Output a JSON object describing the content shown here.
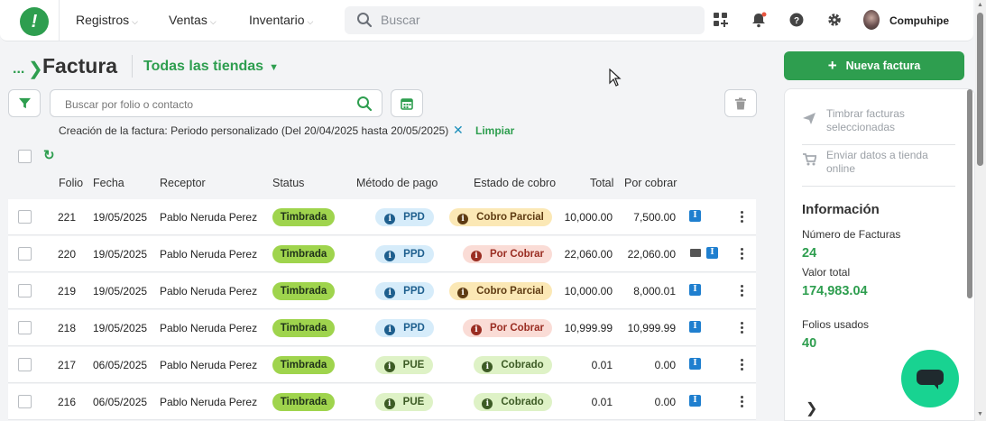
{
  "nav": {
    "items": [
      {
        "label": "Registros"
      },
      {
        "label": "Ventas"
      },
      {
        "label": "Inventario"
      }
    ],
    "search_placeholder": "Buscar",
    "user_name": "Compuhipe"
  },
  "page": {
    "breadcrumb": "...",
    "title": "Factura",
    "store_selector": "Todas las tiendas",
    "search_placeholder": "Buscar por folio o contacto",
    "filter_text": "Creación de la factura: Periodo personalizado (Del 20/04/2025 hasta 20/05/2025)",
    "clear_label": "Limpiar"
  },
  "table": {
    "headers": {
      "folio": "Folio",
      "fecha": "Fecha",
      "receptor": "Receptor",
      "status": "Status",
      "metodo": "Método de pago",
      "estado": "Estado de cobro",
      "total": "Total",
      "por_cobrar": "Por cobrar"
    },
    "rows": [
      {
        "folio": "221",
        "fecha": "19/05/2025",
        "receptor": "Pablo Neruda Perez",
        "status": "Timbrada",
        "metodo": "PPD",
        "estado": "Cobro Parcial",
        "total": "10,000.00",
        "por_cobrar": "7,500.00"
      },
      {
        "folio": "220",
        "fecha": "19/05/2025",
        "receptor": "Pablo Neruda Perez",
        "status": "Timbrada",
        "metodo": "PPD",
        "estado": "Por Cobrar",
        "total": "22,060.00",
        "por_cobrar": "22,060.00"
      },
      {
        "folio": "219",
        "fecha": "19/05/2025",
        "receptor": "Pablo Neruda Perez",
        "status": "Timbrada",
        "metodo": "PPD",
        "estado": "Cobro Parcial",
        "total": "10,000.00",
        "por_cobrar": "8,000.01"
      },
      {
        "folio": "218",
        "fecha": "19/05/2025",
        "receptor": "Pablo Neruda Perez",
        "status": "Timbrada",
        "metodo": "PPD",
        "estado": "Por Cobrar",
        "total": "10,999.99",
        "por_cobrar": "10,999.99"
      },
      {
        "folio": "217",
        "fecha": "06/05/2025",
        "receptor": "Pablo Neruda Perez",
        "status": "Timbrada",
        "metodo": "PUE",
        "estado": "Cobrado",
        "total": "0.01",
        "por_cobrar": "0.00"
      },
      {
        "folio": "216",
        "fecha": "06/05/2025",
        "receptor": "Pablo Neruda Perez",
        "status": "Timbrada",
        "metodo": "PUE",
        "estado": "Cobrado",
        "total": "0.01",
        "por_cobrar": "0.00"
      }
    ]
  },
  "sidebar": {
    "new_invoice_label": "Nueva factura",
    "actions": [
      {
        "label": "Timbrar facturas seleccionadas",
        "icon": "send-icon"
      },
      {
        "label": "Enviar datos a tienda online",
        "icon": "cart-icon"
      }
    ],
    "info_title": "Información",
    "stats": [
      {
        "label": "Número de Facturas",
        "value": "24"
      },
      {
        "label": "Valor total",
        "value": "174,983.04"
      },
      {
        "label": "Folios usados",
        "value": "40"
      }
    ]
  },
  "colors": {
    "brand_green": "#2e9e4f",
    "status_timbrada": "#9fd44d",
    "chat_button": "#18d391"
  }
}
